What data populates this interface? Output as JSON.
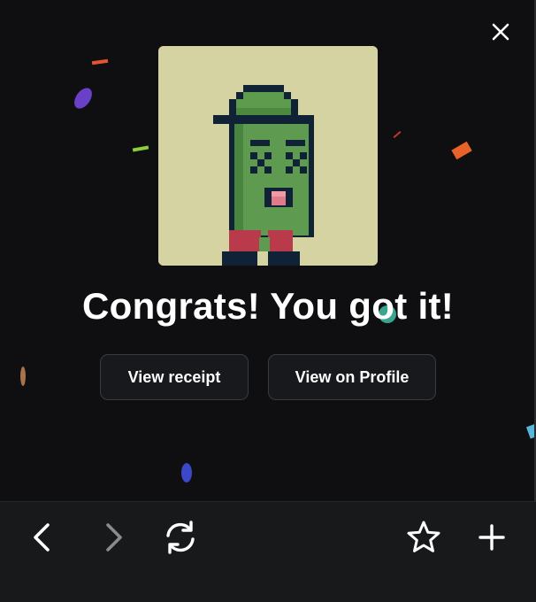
{
  "dialog": {
    "headline": "Congrats! You got it!",
    "image": {
      "subject": "pixel-art green pickle character with bucket hat",
      "background_color": "#d6d3a3"
    },
    "buttons": {
      "view_receipt": "View receipt",
      "view_on_profile": "View on Profile"
    },
    "close_icon": "close-icon"
  },
  "toolbar": {
    "icons": [
      "back-icon",
      "forward-icon",
      "reload-icon",
      "star-icon",
      "add-icon"
    ],
    "forward_enabled": false
  },
  "colors": {
    "background": "#0f0f11",
    "toolbar": "#18191b",
    "button_bg": "#18191c",
    "button_border": "#3a3b40",
    "text": "#ffffff",
    "disabled_icon": "#8a8b90"
  }
}
